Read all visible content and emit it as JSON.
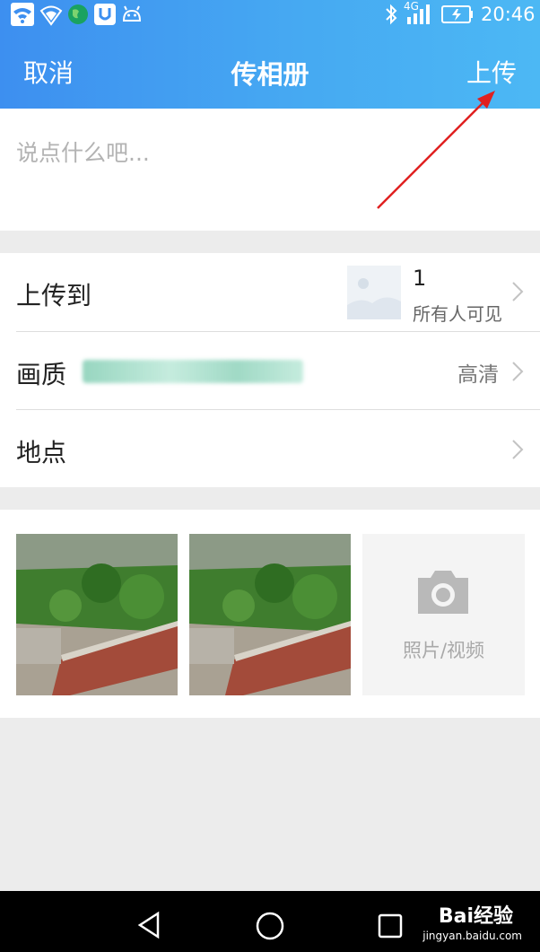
{
  "status_bar": {
    "network": "4G",
    "time": "20:46"
  },
  "header": {
    "cancel": "取消",
    "title": "传相册",
    "upload": "上传"
  },
  "composer": {
    "placeholder": "说点什么吧..."
  },
  "settings": {
    "upload_to": {
      "label": "上传到",
      "album_count": "1",
      "visibility": "所有人可见"
    },
    "quality": {
      "label": "画质",
      "value": "高清"
    },
    "location": {
      "label": "地点"
    }
  },
  "media": {
    "photos": [
      "garden-photo",
      "garden-photo"
    ],
    "add_label": "照片/视频"
  },
  "watermark": {
    "brand": "Bai经验",
    "url": "jingyan.baidu.com"
  },
  "colors": {
    "header_start": "#3d8ff0",
    "header_end": "#4cb8f4",
    "annotation_arrow": "#e02020"
  }
}
